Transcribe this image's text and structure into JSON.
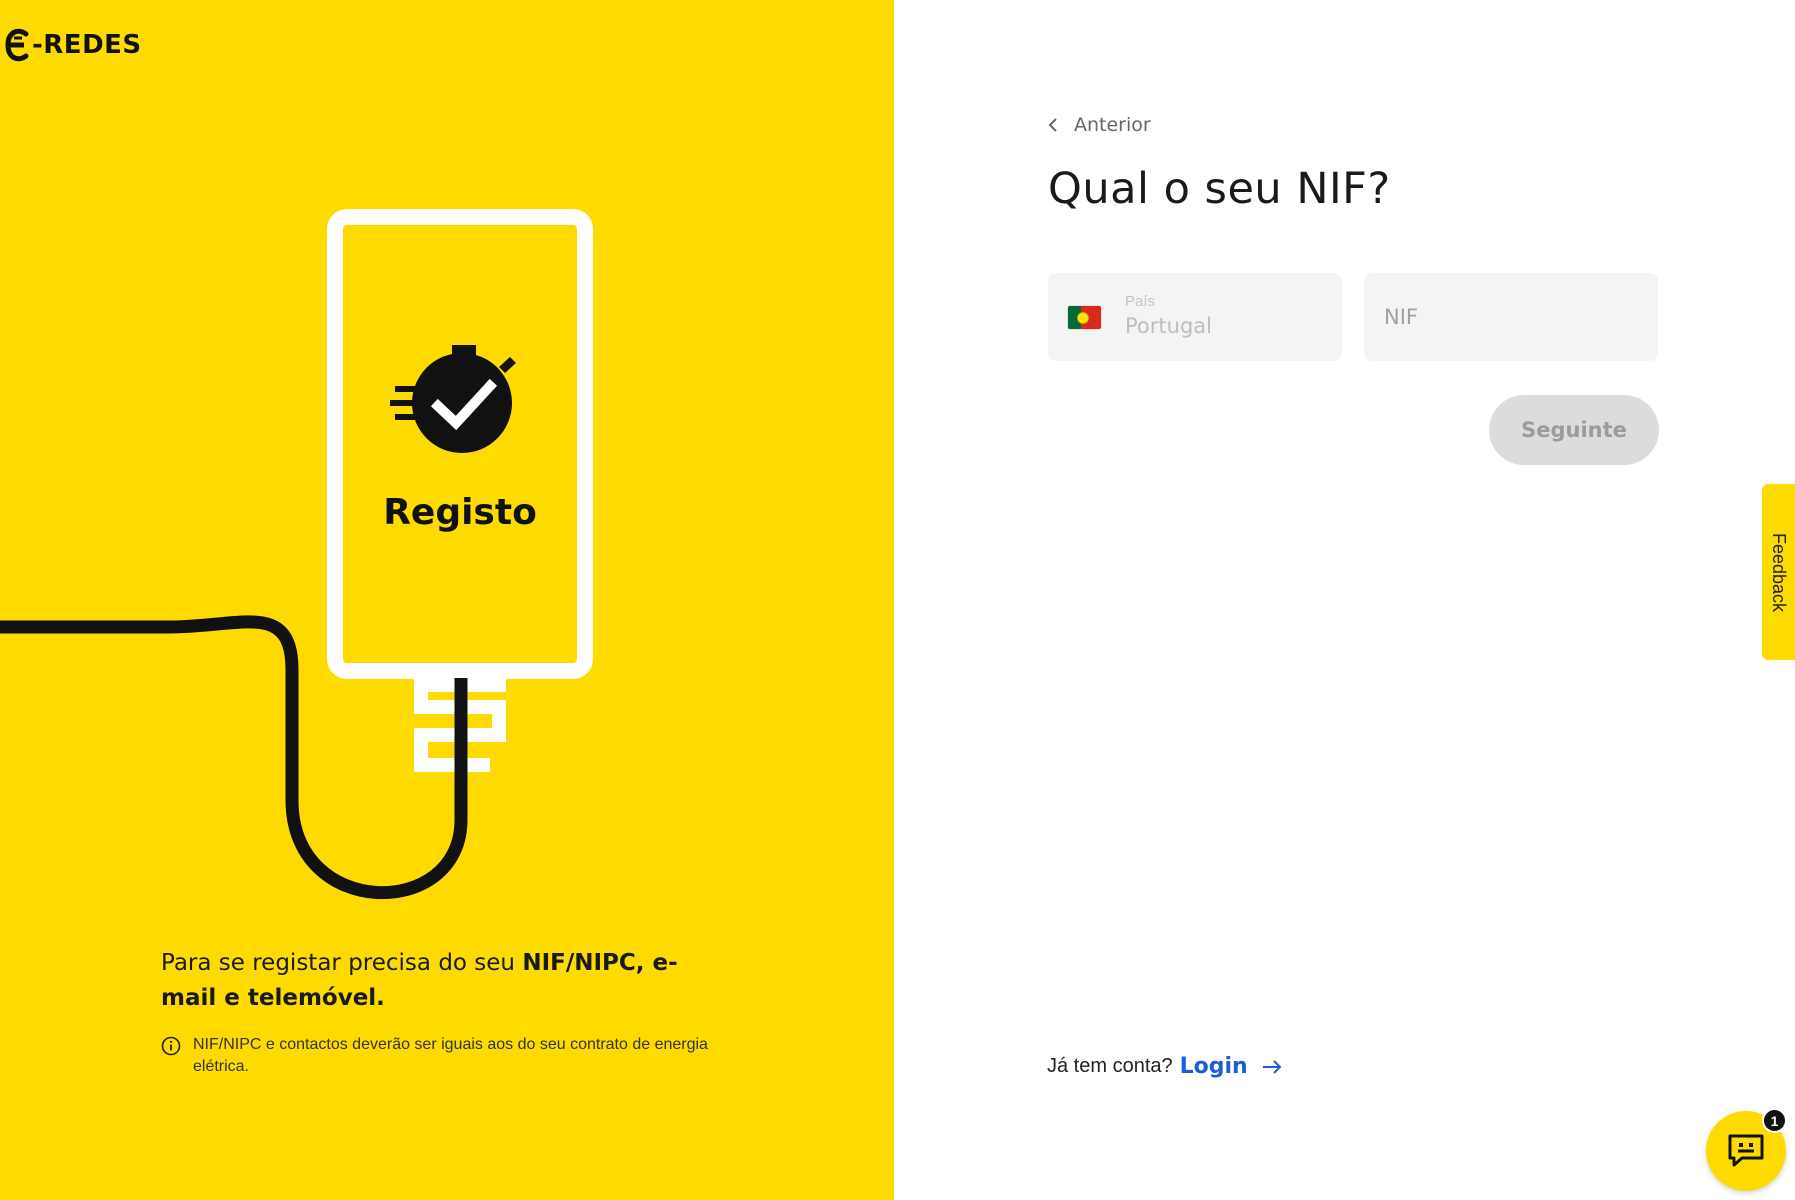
{
  "brand": {
    "logo_text": "-REDES",
    "accent": "#FEDB00"
  },
  "left_panel": {
    "illustration_title": "Registo",
    "intro_text_regular": "Para se registar precisa do seu ",
    "intro_text_bold": "NIF/NIPC, e-mail e telemóvel.",
    "note_text": "NIF/NIPC e contactos deverão ser iguais aos do seu contrato de energia elétrica."
  },
  "form": {
    "back_label": "Anterior",
    "heading": "Qual o seu NIF?",
    "country_label": "País",
    "country_value": "Portugal",
    "nif_placeholder": "NIF",
    "next_button": "Seguinte"
  },
  "footer": {
    "has_account_text": "Já tem conta?",
    "login_label": "Login"
  },
  "feedback_tab": "Feedback",
  "chat": {
    "badge_count": "1"
  }
}
